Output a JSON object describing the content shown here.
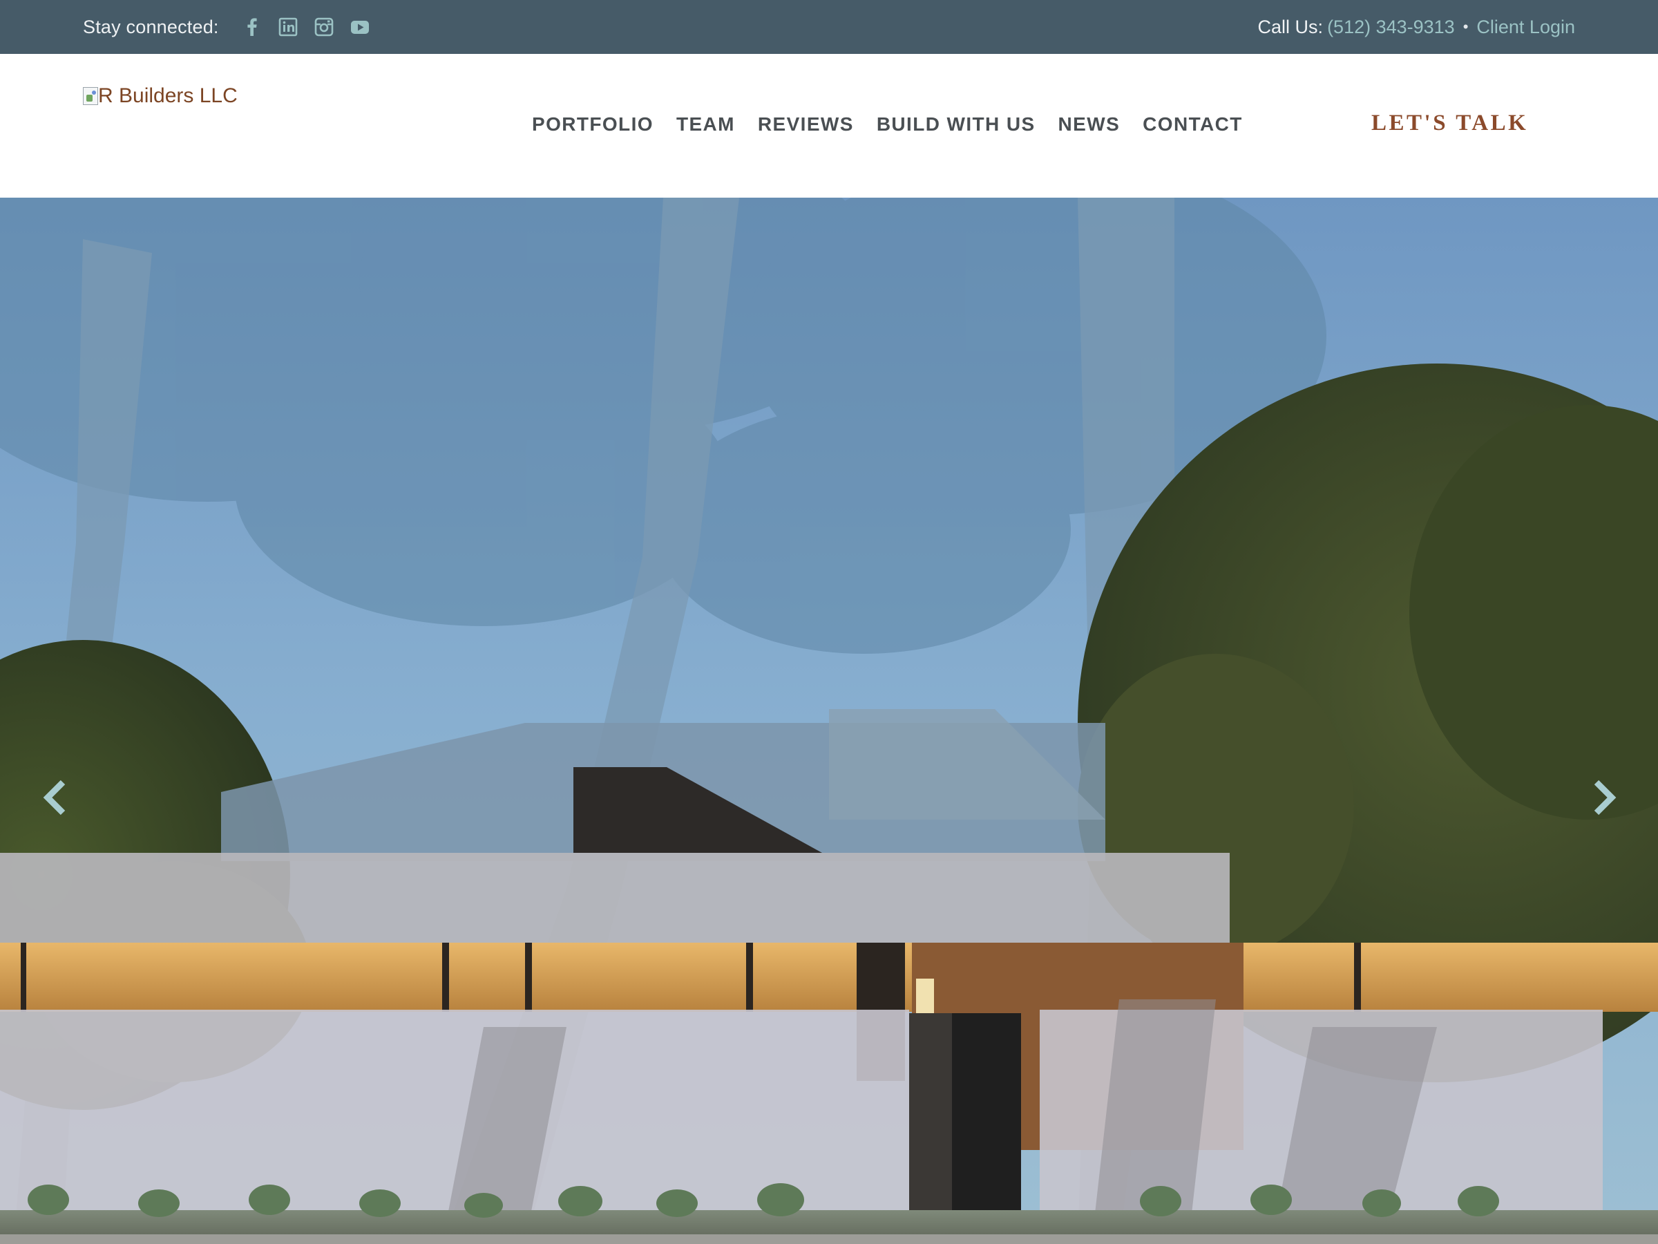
{
  "topbar": {
    "stay_connected": "Stay connected:",
    "social": [
      {
        "icon": "facebook-icon"
      },
      {
        "icon": "linkedin-icon"
      },
      {
        "icon": "instagram-icon"
      },
      {
        "icon": "youtube-icon"
      }
    ],
    "call_label": "Call Us:",
    "phone": "(512) 343-9313",
    "separator": "•",
    "client_login": "Client Login"
  },
  "header": {
    "logo_alt": "R Builders LLC",
    "nav": [
      "PORTFOLIO",
      "TEAM",
      "REVIEWS",
      "BUILD WITH US",
      "NEWS",
      "CONTACT"
    ],
    "cta": "LET'S TALK"
  },
  "hero": {
    "prev_icon": "chevron-left-icon",
    "next_icon": "chevron-right-icon"
  },
  "colors": {
    "topbar_bg": "#465b68",
    "link_teal": "#9bc2c4",
    "brand_brown": "#8b4a2b",
    "nav_text": "#4a4f53"
  }
}
